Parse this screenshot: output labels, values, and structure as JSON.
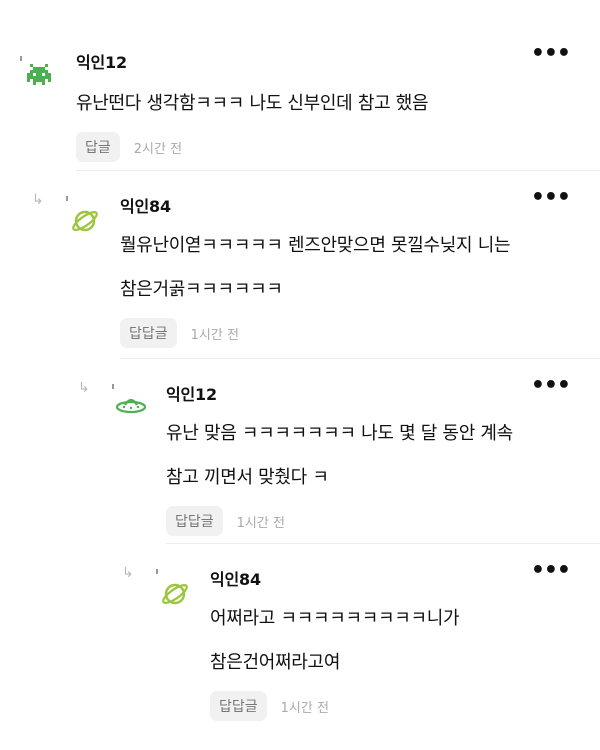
{
  "comments": [
    {
      "name": "익인12",
      "lines": [
        "유난떤다 생각함ㅋㅋㅋ 나도 신부인데 참고 했음"
      ],
      "reply_label": "답글",
      "time": "2시간 전",
      "avatar_icon": "space-invader-icon",
      "avatar_color": "#4caf50"
    },
    {
      "name": "익인84",
      "lines": [
        "뭘유난이엳ㅋㅋㅋㅋㅋ 렌즈안맞으면 못낄수닞지 니는",
        "참은거곩ㅋㅋㅋㅋㅋㅋ"
      ],
      "reply_label": "답답글",
      "time": "1시간 전",
      "avatar_icon": "planet-icon",
      "avatar_color": "#9bc53d"
    },
    {
      "name": "익인12",
      "lines": [
        "유난 맞음 ㅋㅋㅋㅋㅋㅋㅋ 나도 몇 달 동안 계속",
        "참고 끼면서 맞췄다 ㅋ"
      ],
      "reply_label": "답답글",
      "time": "1시간 전",
      "avatar_icon": "ufo-icon",
      "avatar_color": "#4caf50"
    },
    {
      "name": "익인84",
      "lines": [
        "어쩌라고 ㅋㅋㅋㅋㅋㅋㅋㅋㅋ니가",
        "참은건어쩌라고여"
      ],
      "reply_label": "답답글",
      "time": "1시간 전",
      "avatar_icon": "planet-icon",
      "avatar_color": "#9bc53d"
    }
  ],
  "more_label": "•••"
}
